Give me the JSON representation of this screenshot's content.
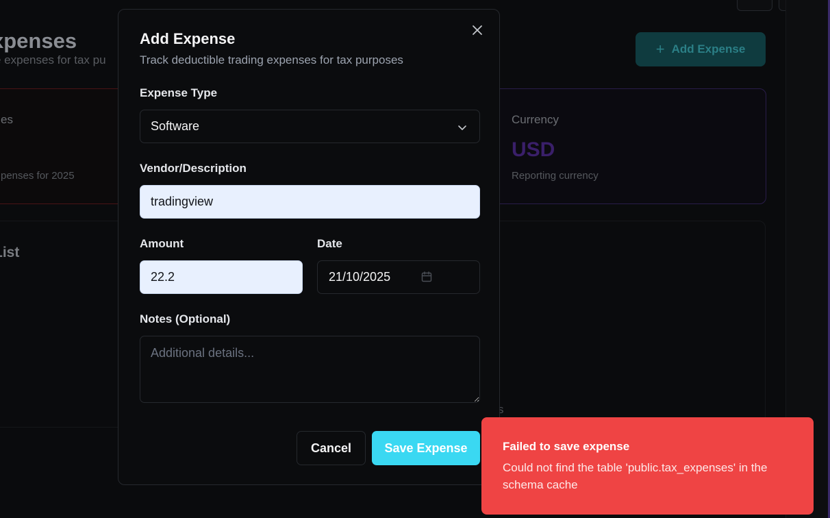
{
  "background": {
    "page_title": "xpenses",
    "page_subtitle": "e expenses for tax pu",
    "add_button_label": "Add Expense",
    "summary_card_left": {
      "title": "es",
      "subtitle": "penses for 2025"
    },
    "currency_card": {
      "title": "Currency",
      "value": "USD",
      "subtitle": "Reporting currency"
    },
    "list_title": "List",
    "list_fragment": "s"
  },
  "modal": {
    "title": "Add Expense",
    "description": "Track deductible trading expenses for tax purposes",
    "expense_type": {
      "label": "Expense Type",
      "value": "Software"
    },
    "vendor": {
      "label": "Vendor/Description",
      "value": "tradingview"
    },
    "amount": {
      "label": "Amount",
      "value": "22.2"
    },
    "date": {
      "label": "Date",
      "value": "21/10/2025"
    },
    "notes": {
      "label": "Notes (Optional)",
      "placeholder": "Additional details..."
    },
    "cancel_label": "Cancel",
    "save_label": "Save Expense"
  },
  "toast": {
    "title": "Failed to save expense",
    "message": "Could not find the table 'public.tax_expenses' in the schema cache",
    "color": "#ef4444"
  },
  "icons": {
    "close": "close-icon",
    "chevron": "chevron-down-icon",
    "calendar": "calendar-icon",
    "plus": "plus-icon"
  }
}
